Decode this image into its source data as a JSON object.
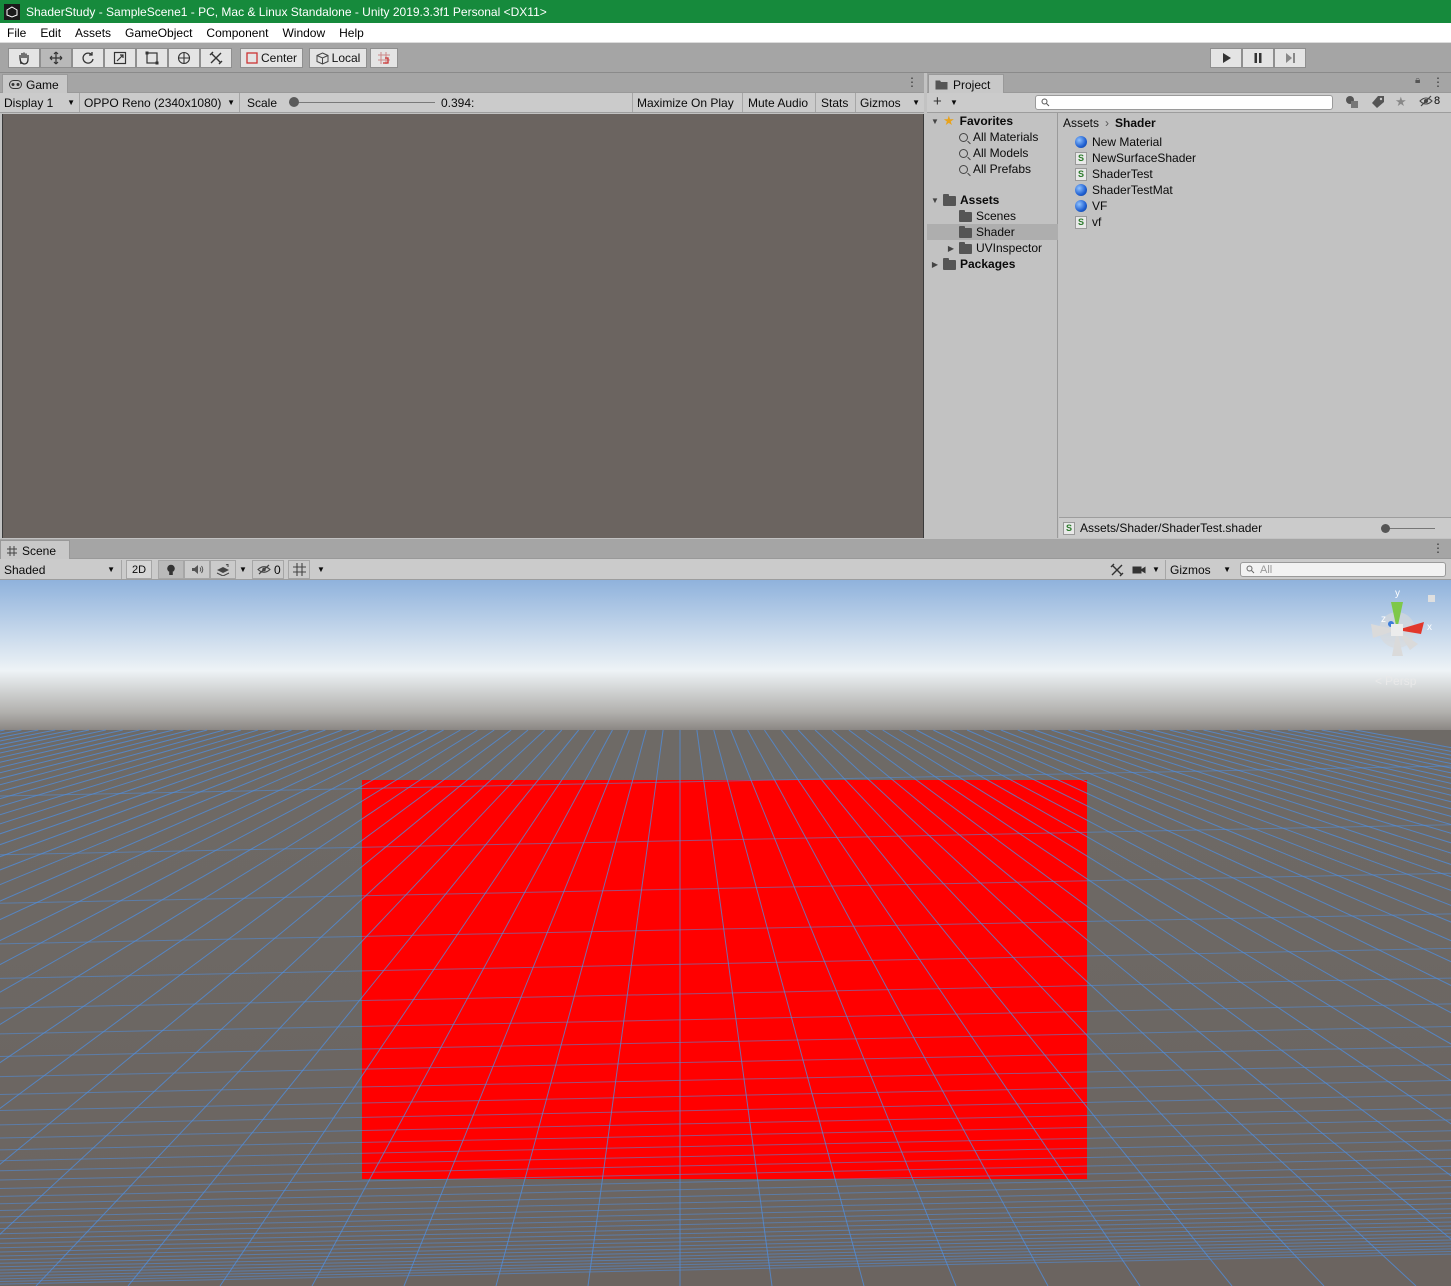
{
  "window": {
    "title": "ShaderStudy - SampleScene1 - PC, Mac & Linux Standalone - Unity 2019.3.3f1 Personal <DX11>"
  },
  "menu": [
    "File",
    "Edit",
    "Assets",
    "GameObject",
    "Component",
    "Window",
    "Help"
  ],
  "toolbar": {
    "pivot_label": "Center",
    "space_label": "Local"
  },
  "game": {
    "tab_label": "Game",
    "display_label": "Display 1",
    "resolution_label": "OPPO Reno (2340x1080)",
    "scale_label": "Scale",
    "scale_value": "0.394:",
    "scale_fraction": 0.0,
    "maximize_label": "Maximize On Play",
    "mute_label": "Mute Audio",
    "stats_label": "Stats",
    "gizmos_label": "Gizmos",
    "view_color": "#6b6460"
  },
  "project": {
    "tab_label": "Project",
    "hidden_count": "8",
    "tree": {
      "favorites_label": "Favorites",
      "favorites": [
        "All Materials",
        "All Models",
        "All Prefabs"
      ],
      "assets_label": "Assets",
      "asset_folders": [
        "Scenes",
        "Shader",
        "UVInspector"
      ],
      "selected_folder": "Shader",
      "packages_label": "Packages"
    },
    "breadcrumb": {
      "root": "Assets",
      "current": "Shader"
    },
    "items": [
      {
        "name": "New Material",
        "icon": "material-icon"
      },
      {
        "name": "NewSurfaceShader",
        "icon": "shader-icon"
      },
      {
        "name": "ShaderTest",
        "icon": "shader-icon"
      },
      {
        "name": "ShaderTestMat",
        "icon": "material-icon"
      },
      {
        "name": "VF",
        "icon": "material-icon"
      },
      {
        "name": "vf",
        "icon": "shader-icon"
      }
    ],
    "status_path": "Assets/Shader/ShaderTest.shader"
  },
  "scene": {
    "tab_label": "Scene",
    "draw_mode": "Shaded",
    "mode_2d_label": "2D",
    "hidden_count": "0",
    "gizmos_label": "Gizmos",
    "search_placeholder": "All",
    "persp_label": "Persp",
    "gizmo_axes": {
      "y": "y",
      "x": "x",
      "z": "z"
    },
    "plane_color": "#ff0000",
    "grid_color": "#4f8fe0"
  }
}
